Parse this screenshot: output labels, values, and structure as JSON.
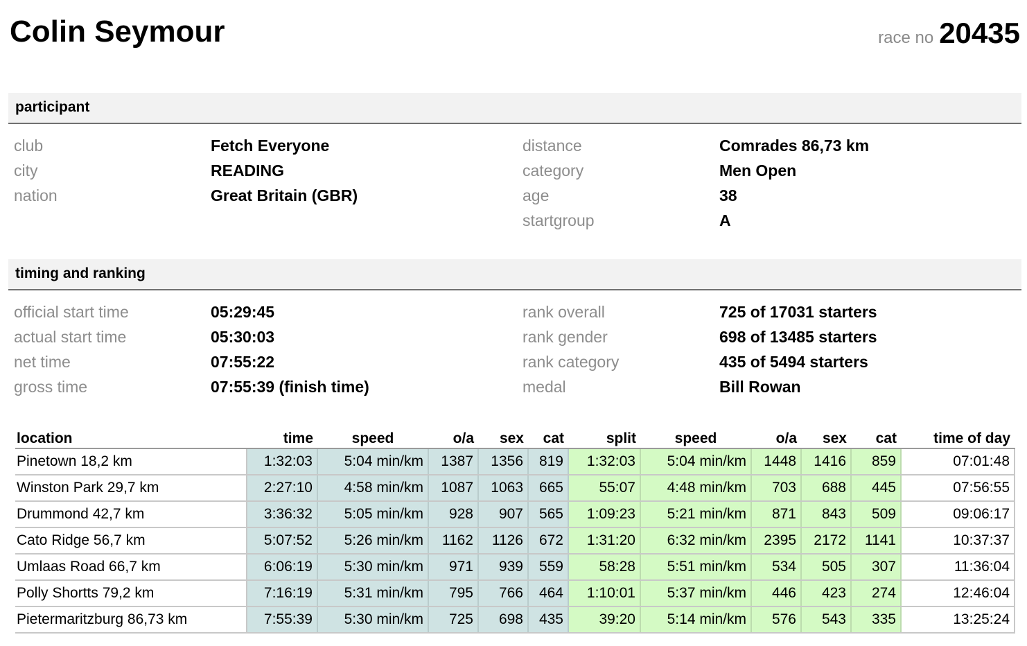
{
  "header": {
    "name": "Colin Seymour",
    "race_no_label": "race no",
    "race_no": "20435"
  },
  "participant": {
    "title": "participant",
    "left": [
      {
        "label": "club",
        "value": "Fetch Everyone"
      },
      {
        "label": "city",
        "value": "READING"
      },
      {
        "label": "nation",
        "value": "Great Britain (GBR)"
      }
    ],
    "right": [
      {
        "label": "distance",
        "value": "Comrades 86,73 km"
      },
      {
        "label": "category",
        "value": "Men Open"
      },
      {
        "label": "age",
        "value": "38"
      },
      {
        "label": "startgroup",
        "value": "A"
      }
    ]
  },
  "timing": {
    "title": "timing and ranking",
    "left": [
      {
        "label": "official start time",
        "value": "05:29:45"
      },
      {
        "label": "actual start time",
        "value": "05:30:03"
      },
      {
        "label": "net time",
        "value": "07:55:22"
      },
      {
        "label": "gross time",
        "value": "07:55:39 (finish time)"
      }
    ],
    "right": [
      {
        "label": "rank overall",
        "value": "725 of 17031 starters"
      },
      {
        "label": "rank gender",
        "value": "698 of 13485 starters"
      },
      {
        "label": "rank category",
        "value": "435 of 5494 starters"
      },
      {
        "label": "medal",
        "value": "Bill Rowan"
      }
    ]
  },
  "splits": {
    "headers": [
      "location",
      "time",
      "speed",
      "o/a",
      "sex",
      "cat",
      "split",
      "speed",
      "o/a",
      "sex",
      "cat",
      "time of day"
    ],
    "rows": [
      [
        "Pinetown 18,2 km",
        "1:32:03",
        "5:04 min/km",
        "1387",
        "1356",
        "819",
        "1:32:03",
        "5:04 min/km",
        "1448",
        "1416",
        "859",
        "07:01:48"
      ],
      [
        "Winston Park 29,7 km",
        "2:27:10",
        "4:58 min/km",
        "1087",
        "1063",
        "665",
        "55:07",
        "4:48 min/km",
        "703",
        "688",
        "445",
        "07:56:55"
      ],
      [
        "Drummond 42,7 km",
        "3:36:32",
        "5:05 min/km",
        "928",
        "907",
        "565",
        "1:09:23",
        "5:21 min/km",
        "871",
        "843",
        "509",
        "09:06:17"
      ],
      [
        "Cato Ridge 56,7 km",
        "5:07:52",
        "5:26 min/km",
        "1162",
        "1126",
        "672",
        "1:31:20",
        "6:32 min/km",
        "2395",
        "2172",
        "1141",
        "10:37:37"
      ],
      [
        "Umlaas Road 66,7 km",
        "6:06:19",
        "5:30 min/km",
        "971",
        "939",
        "559",
        "58:28",
        "5:51 min/km",
        "534",
        "505",
        "307",
        "11:36:04"
      ],
      [
        "Polly Shortts 79,2 km",
        "7:16:19",
        "5:31 min/km",
        "795",
        "766",
        "464",
        "1:10:01",
        "5:37 min/km",
        "446",
        "423",
        "274",
        "12:46:04"
      ],
      [
        "Pietermaritzburg 86,73 km",
        "7:55:39",
        "5:30 min/km",
        "725",
        "698",
        "435",
        "39:20",
        "5:14 min/km",
        "576",
        "543",
        "335",
        "13:25:24"
      ]
    ]
  },
  "colors": {
    "cumulative_bg": "#cfe3e3",
    "split_bg": "#d4fac4",
    "label_gray": "#8d8d8d"
  }
}
